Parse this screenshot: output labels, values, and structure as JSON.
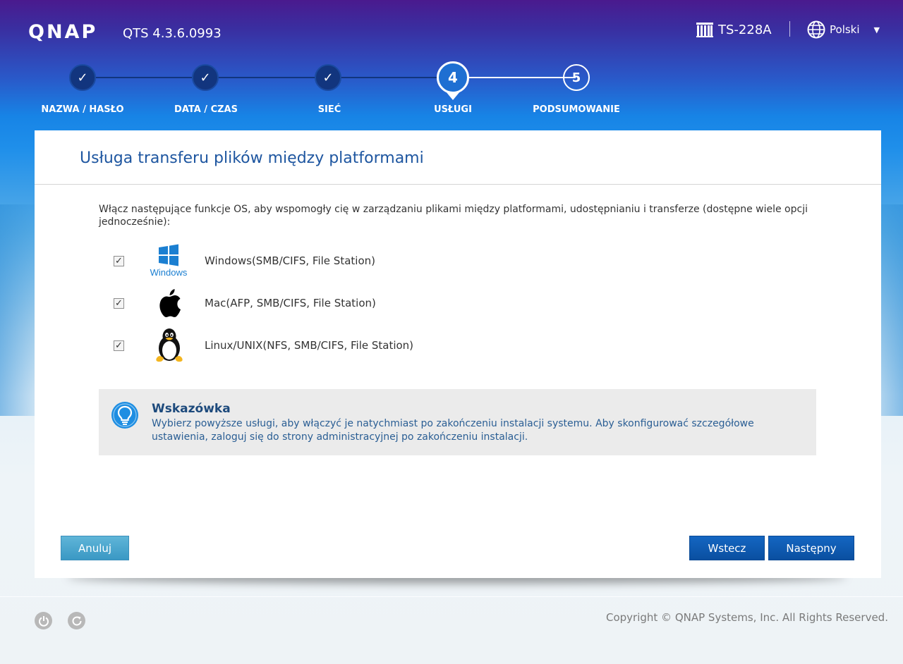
{
  "header": {
    "logo": "QNAP",
    "version": "QTS 4.3.6.0993",
    "model": "TS-228A",
    "language": "Polski"
  },
  "steps": [
    {
      "label": "NAZWA / HASŁO",
      "state": "done",
      "number": "1"
    },
    {
      "label": "DATA / CZAS",
      "state": "done",
      "number": "2"
    },
    {
      "label": "SIEĆ",
      "state": "done",
      "number": "3"
    },
    {
      "label": "USŁUGI",
      "state": "current",
      "number": "4"
    },
    {
      "label": "PODSUMOWANIE",
      "state": "pending",
      "number": "5"
    }
  ],
  "panel": {
    "title": "Usługa transferu plików między platformami",
    "intro": "Włącz następujące funkcje OS, aby wspomogły cię w zarządzaniu plikami między platformami, udostępnianiu i transferze (dostępne wiele opcji jednocześnie):",
    "options": [
      {
        "label": "Windows(SMB/CIFS, File Station)",
        "checked": true,
        "icon": "windows-icon",
        "icon_text": "Windows"
      },
      {
        "label": "Mac(AFP, SMB/CIFS, File Station)",
        "checked": true,
        "icon": "apple-icon"
      },
      {
        "label": "Linux/UNIX(NFS, SMB/CIFS, File Station)",
        "checked": true,
        "icon": "linux-tux-icon"
      }
    ],
    "tip": {
      "title": "Wskazówka",
      "text": "Wybierz powyższe usługi, aby włączyć je natychmiast po zakończeniu instalacji systemu. Aby skonfigurować szczegółowe ustawienia, zaloguj się do strony administracyjnej po zakończeniu instalacji."
    },
    "buttons": {
      "cancel": "Anuluj",
      "back": "Wstecz",
      "next": "Następny"
    }
  },
  "footer": {
    "copyright": "Copyright © QNAP Systems, Inc. All Rights Reserved."
  },
  "colors": {
    "accent": "#1e56a0",
    "button_primary": "#0a4fa0",
    "button_cancel": "#3a98c4"
  }
}
